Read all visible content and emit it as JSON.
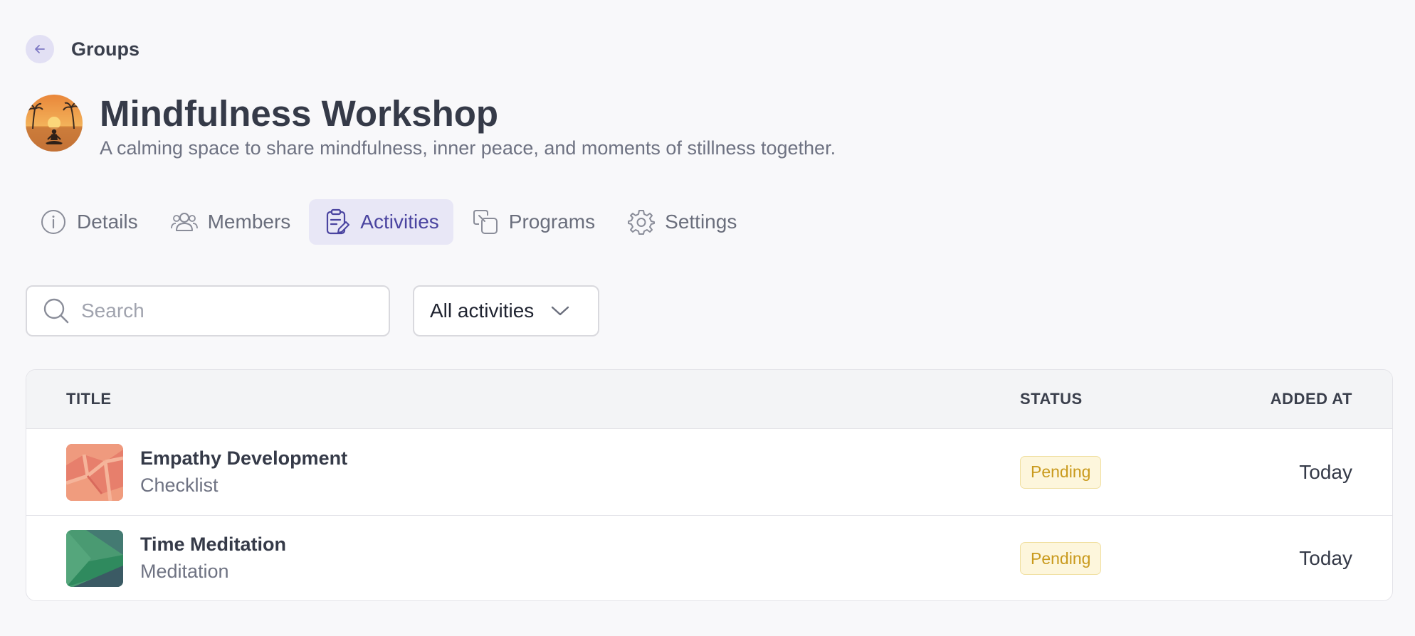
{
  "nav": {
    "back_label": "Groups"
  },
  "group": {
    "title": "Mindfulness Workshop",
    "description": "A calming space to share mindfulness, inner peace, and moments of stillness together."
  },
  "tabs": [
    {
      "label": "Details",
      "icon": "info-icon"
    },
    {
      "label": "Members",
      "icon": "users-icon"
    },
    {
      "label": "Activities",
      "icon": "clipboard-edit-icon",
      "active": true
    },
    {
      "label": "Programs",
      "icon": "copy-icon"
    },
    {
      "label": "Settings",
      "icon": "gear-icon"
    }
  ],
  "filters": {
    "search_placeholder": "Search",
    "activity_filter": "All activities"
  },
  "table": {
    "headers": {
      "title": "TITLE",
      "status": "STATUS",
      "added_at": "ADDED AT"
    },
    "rows": [
      {
        "title": "Empathy Development",
        "type": "Checklist",
        "status": "Pending",
        "added_at": "Today"
      },
      {
        "title": "Time Meditation",
        "type": "Meditation",
        "status": "Pending",
        "added_at": "Today"
      }
    ]
  },
  "colors": {
    "accent": "#4a44a0",
    "tab_active_bg": "#e8e7f6",
    "pending_text": "#c99a1d",
    "pending_bg": "#fdf6dc"
  }
}
